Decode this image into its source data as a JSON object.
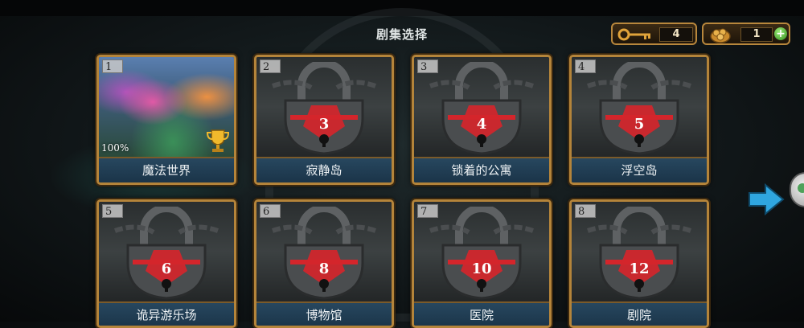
{
  "header": {
    "title": "剧集选择"
  },
  "resources": {
    "keys": "4",
    "coins": "1",
    "add_label": "+"
  },
  "episodes": [
    {
      "number": "1",
      "name": "魔法世界",
      "progress": "100%",
      "locked": false,
      "unlock_cost": ""
    },
    {
      "number": "2",
      "name": "寂静岛",
      "locked": true,
      "unlock_cost": "3"
    },
    {
      "number": "3",
      "name": "锁着的公寓",
      "locked": true,
      "unlock_cost": "4"
    },
    {
      "number": "4",
      "name": "浮空岛",
      "locked": true,
      "unlock_cost": "5"
    },
    {
      "number": "5",
      "name": "诡异游乐场",
      "locked": true,
      "unlock_cost": "6"
    },
    {
      "number": "6",
      "name": "博物馆",
      "locked": true,
      "unlock_cost": "8"
    },
    {
      "number": "7",
      "name": "医院",
      "locked": true,
      "unlock_cost": "10"
    },
    {
      "number": "8",
      "name": "剧院",
      "locked": true,
      "unlock_cost": "12"
    }
  ],
  "colors": {
    "frame_gold": "#b4843a",
    "label_blue": "#1a3347",
    "lock_red": "#d4252b",
    "arrow_blue": "#2fa6e0"
  },
  "icons": {
    "key": "key-icon",
    "coin": "coin-bag-icon",
    "add": "plus-icon",
    "lock": "padlock-icon",
    "trophy": "trophy-icon",
    "next": "arrow-right-icon"
  }
}
